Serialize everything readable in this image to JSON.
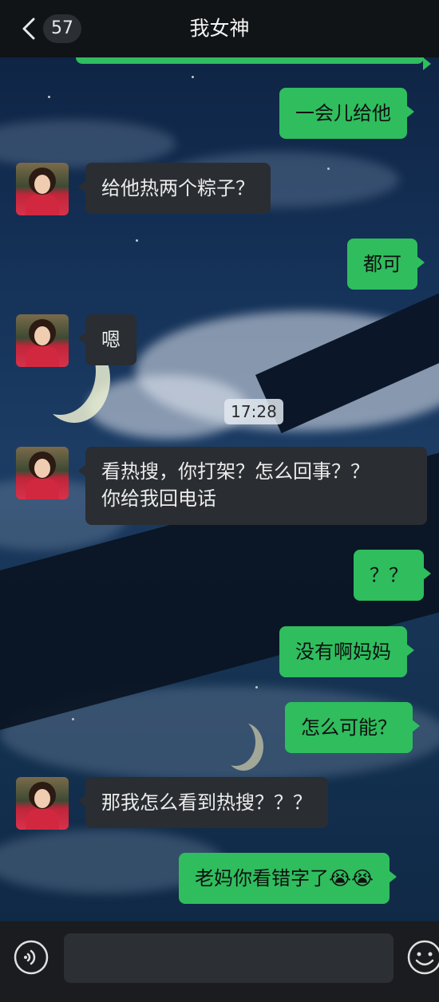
{
  "header": {
    "unread_count": "57",
    "title": "我女神"
  },
  "messages": [
    {
      "side": "out",
      "text": "一会儿给他"
    },
    {
      "side": "in",
      "text": "给他热两个粽子？"
    },
    {
      "side": "out",
      "text": "都可"
    },
    {
      "side": "in",
      "text": "嗯"
    },
    {
      "side": "in",
      "text_line1": "看热搜，你打架？怎么回事？？",
      "text_line2": "你给我回电话"
    },
    {
      "side": "out",
      "text": "？？"
    },
    {
      "side": "out",
      "text": "没有啊妈妈"
    },
    {
      "side": "out",
      "text": "怎么可能？"
    },
    {
      "side": "in",
      "text": "那我怎么看到热搜？？？"
    },
    {
      "side": "out",
      "text": "老妈你看错字了😭😭"
    }
  ],
  "timestamp": "17:28",
  "colors": {
    "outgoing_bubble": "#2fbd5e",
    "incoming_bubble": "#2a2d31",
    "topbar": "#101417"
  },
  "icons": {
    "back": "chevron-left-icon",
    "voice": "voice-icon",
    "emoji": "emoji-icon"
  }
}
